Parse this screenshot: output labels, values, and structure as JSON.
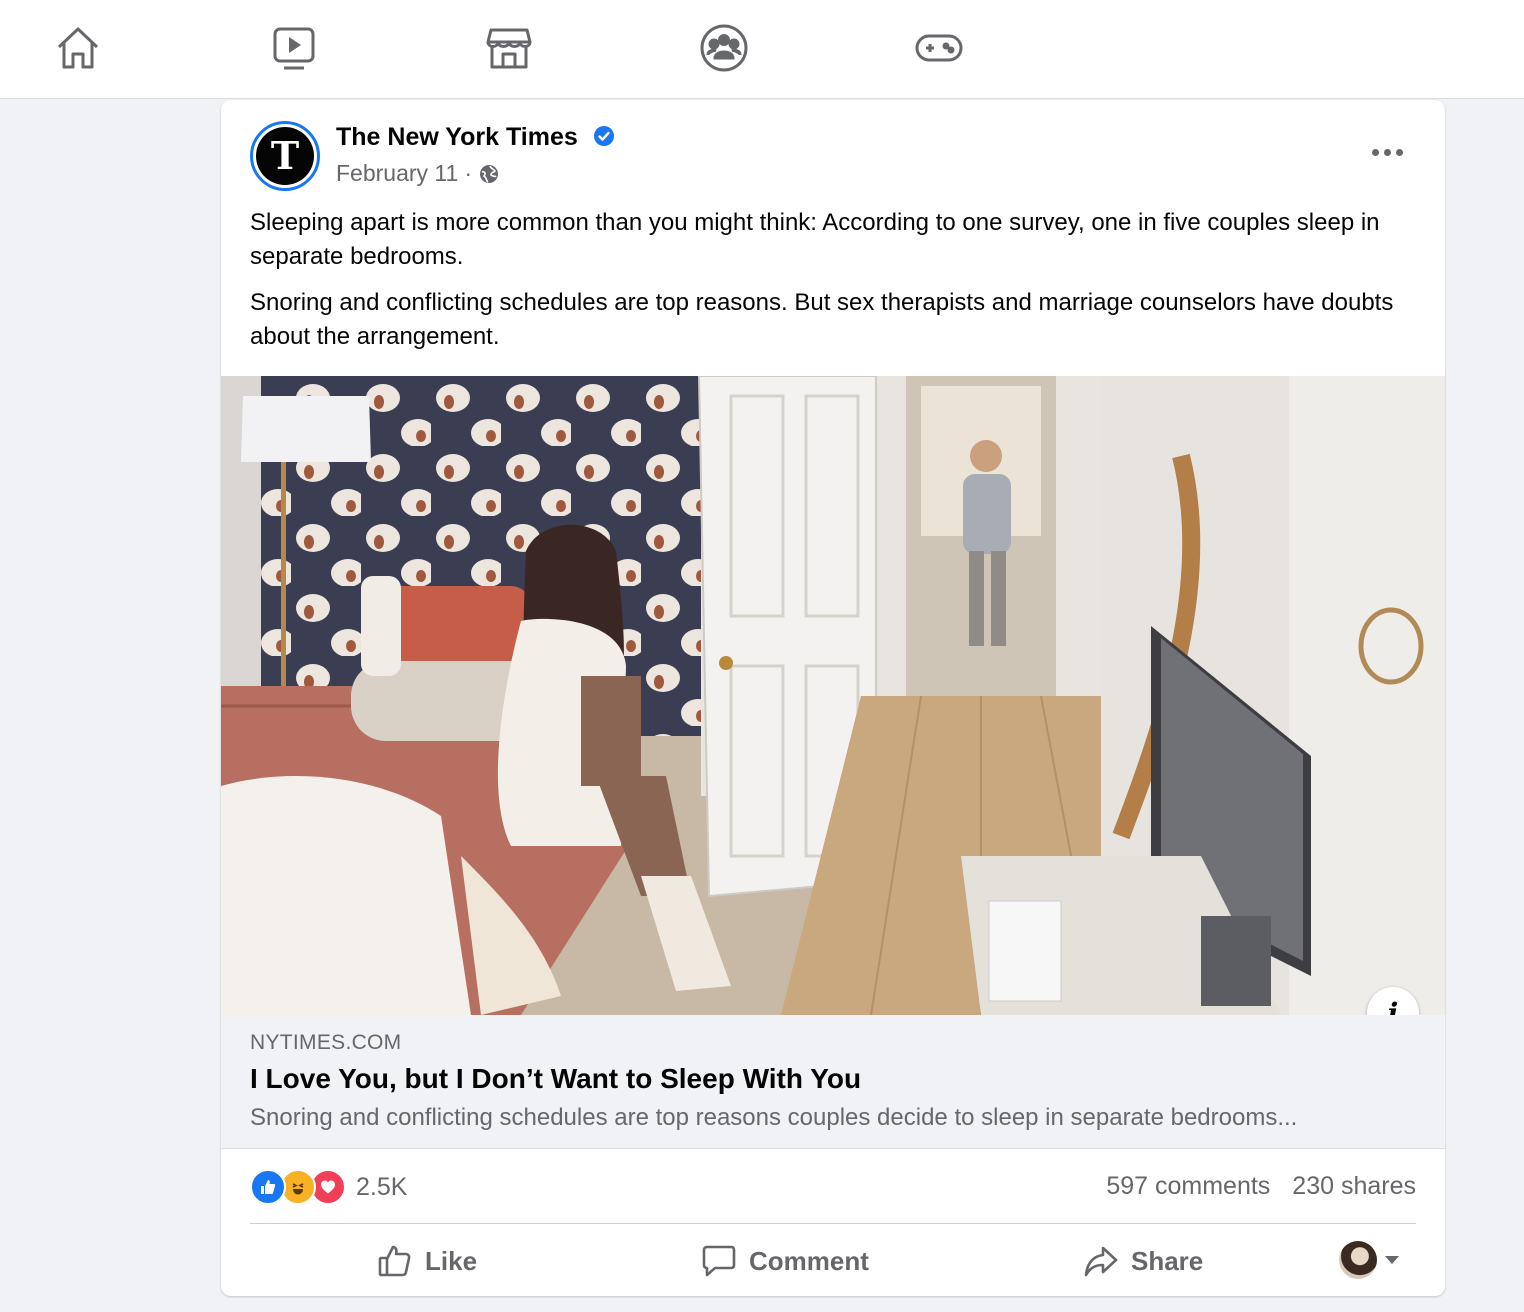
{
  "nav": {
    "icons": [
      "home-icon",
      "watch-icon",
      "marketplace-icon",
      "groups-icon",
      "gaming-icon"
    ]
  },
  "post": {
    "page_name": "The New York Times",
    "avatar_letter": "T",
    "date": "February 11",
    "separator": "·",
    "paragraphs": [
      "Sleeping apart is more common than you might think: According to one survey, one in five couples sleep in separate bedrooms.",
      "Snoring and conflicting schedules are top reasons. But sex therapists and marriage counselors have doubts about the arrangement."
    ],
    "info_label": "i",
    "link": {
      "domain": "NYTIMES.COM",
      "title": "I Love You, but I Don’t Want to Sleep With You",
      "description": "Snoring and conflicting schedules are top reasons couples decide to sleep in separate bedrooms..."
    },
    "reactions": {
      "types": [
        "like",
        "haha",
        "love"
      ],
      "count": "2.5K"
    },
    "comments": "597 comments",
    "shares": "230 shares",
    "actions": {
      "like": "Like",
      "comment": "Comment",
      "share": "Share"
    }
  },
  "colors": {
    "accent": "#1877f2",
    "secondary_text": "#65676b",
    "background": "#f0f2f5"
  }
}
